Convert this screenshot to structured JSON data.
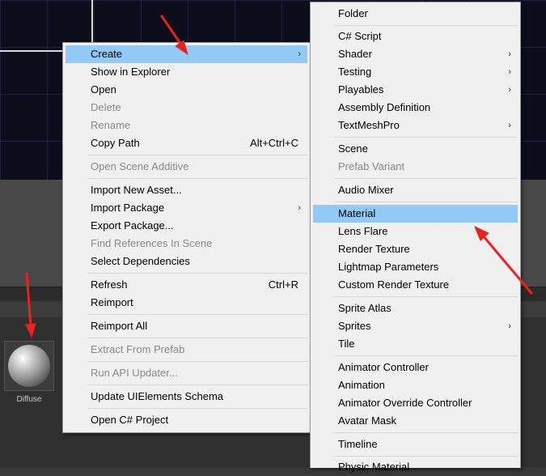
{
  "asset": {
    "label": "Diffuse",
    "icon": "material-sphere-icon"
  },
  "main_menu": {
    "create": "Create",
    "show_in_explorer": "Show in Explorer",
    "open": "Open",
    "delete": "Delete",
    "rename": "Rename",
    "copy_path": "Copy Path",
    "copy_path_shortcut": "Alt+Ctrl+C",
    "open_scene_additive": "Open Scene Additive",
    "import_new_asset": "Import New Asset...",
    "import_package": "Import Package",
    "export_package": "Export Package...",
    "find_references": "Find References In Scene",
    "select_dependencies": "Select Dependencies",
    "refresh": "Refresh",
    "refresh_shortcut": "Ctrl+R",
    "reimport": "Reimport",
    "reimport_all": "Reimport All",
    "extract_from_prefab": "Extract From Prefab",
    "run_api_updater": "Run API Updater...",
    "update_uielements": "Update UIElements Schema",
    "open_csharp_project": "Open C# Project"
  },
  "sub_menu": {
    "folder": "Folder",
    "csharp_script": "C# Script",
    "shader": "Shader",
    "testing": "Testing",
    "playables": "Playables",
    "assembly_definition": "Assembly Definition",
    "textmeshpro": "TextMeshPro",
    "scene": "Scene",
    "prefab_variant": "Prefab Variant",
    "audio_mixer": "Audio Mixer",
    "material": "Material",
    "lens_flare": "Lens Flare",
    "render_texture": "Render Texture",
    "lightmap_parameters": "Lightmap Parameters",
    "custom_render_texture": "Custom Render Texture",
    "sprite_atlas": "Sprite Atlas",
    "sprites": "Sprites",
    "tile": "Tile",
    "animator_controller": "Animator Controller",
    "animation": "Animation",
    "animator_override_controller": "Animator Override Controller",
    "avatar_mask": "Avatar Mask",
    "timeline": "Timeline",
    "physic_material": "Physic Material"
  },
  "submenu_arrow": "›",
  "colors": {
    "highlight": "#91c9f7",
    "arrow": "#e8231f"
  }
}
